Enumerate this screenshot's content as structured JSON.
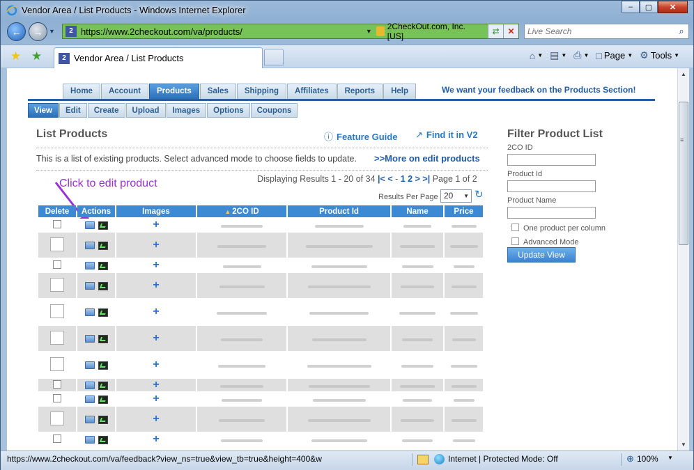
{
  "window": {
    "title": "Vendor Area / List Products - Windows Internet Explorer"
  },
  "address": {
    "url": "https://www.2checkout.com/va/products/",
    "site_icon": "2",
    "certificate": "2CheckOut.com, Inc. [US]"
  },
  "search": {
    "placeholder": "Live Search"
  },
  "tab": {
    "label": "Vendor Area / List Products",
    "site_icon": "2"
  },
  "commands": {
    "page": "Page",
    "tools": "Tools"
  },
  "site_nav": {
    "main_tabs": [
      "Home",
      "Account",
      "Products",
      "Sales",
      "Shipping",
      "Affiliates",
      "Reports",
      "Help"
    ],
    "active_main": "Products",
    "sub_tabs": [
      "View",
      "Edit",
      "Create",
      "Upload",
      "Images",
      "Options",
      "Coupons"
    ],
    "active_sub": "View",
    "feedback": "We want your feedback on the Products Section!"
  },
  "content": {
    "title": "List Products",
    "feature_guide": "Feature Guide",
    "find_v2": "Find it in V2",
    "intro": "This is a list of existing products. Select advanced mode to choose fields to update.",
    "more_edit": ">>More on edit products",
    "pager": {
      "displaying": "Displaying Results 1 - 20 of 34",
      "first": "|<",
      "prev": "<",
      "page1": "1",
      "page2": "2",
      "next": ">",
      "last": ">|",
      "page_of": "Page 1 of 2"
    },
    "results_per_page_label": "Results Per Page",
    "results_per_page_value": "20",
    "annotation": "Click to edit product"
  },
  "table": {
    "headers": [
      "Delete",
      "Actions",
      "Images",
      "2CO ID",
      "Product Id",
      "Name",
      "Price"
    ],
    "sort_indicator": "▲"
  },
  "filter": {
    "title": "Filter Product List",
    "fields": [
      "2CO ID",
      "Product Id",
      "Product Name"
    ],
    "options": [
      "One product per column",
      "Advanced Mode"
    ],
    "update_button": "Update View"
  },
  "status": {
    "url": "https://www.2checkout.com/va/feedback?view_ns=true&view_tb=true&height=400&w",
    "zone": "Internet | Protected Mode: Off",
    "zoom": "100%"
  },
  "colors": {
    "accent": "#3c8ad4",
    "nav_active": "#2a6fb8",
    "annotation": "#9a30d6",
    "address_bar_secure": "#78c357"
  }
}
